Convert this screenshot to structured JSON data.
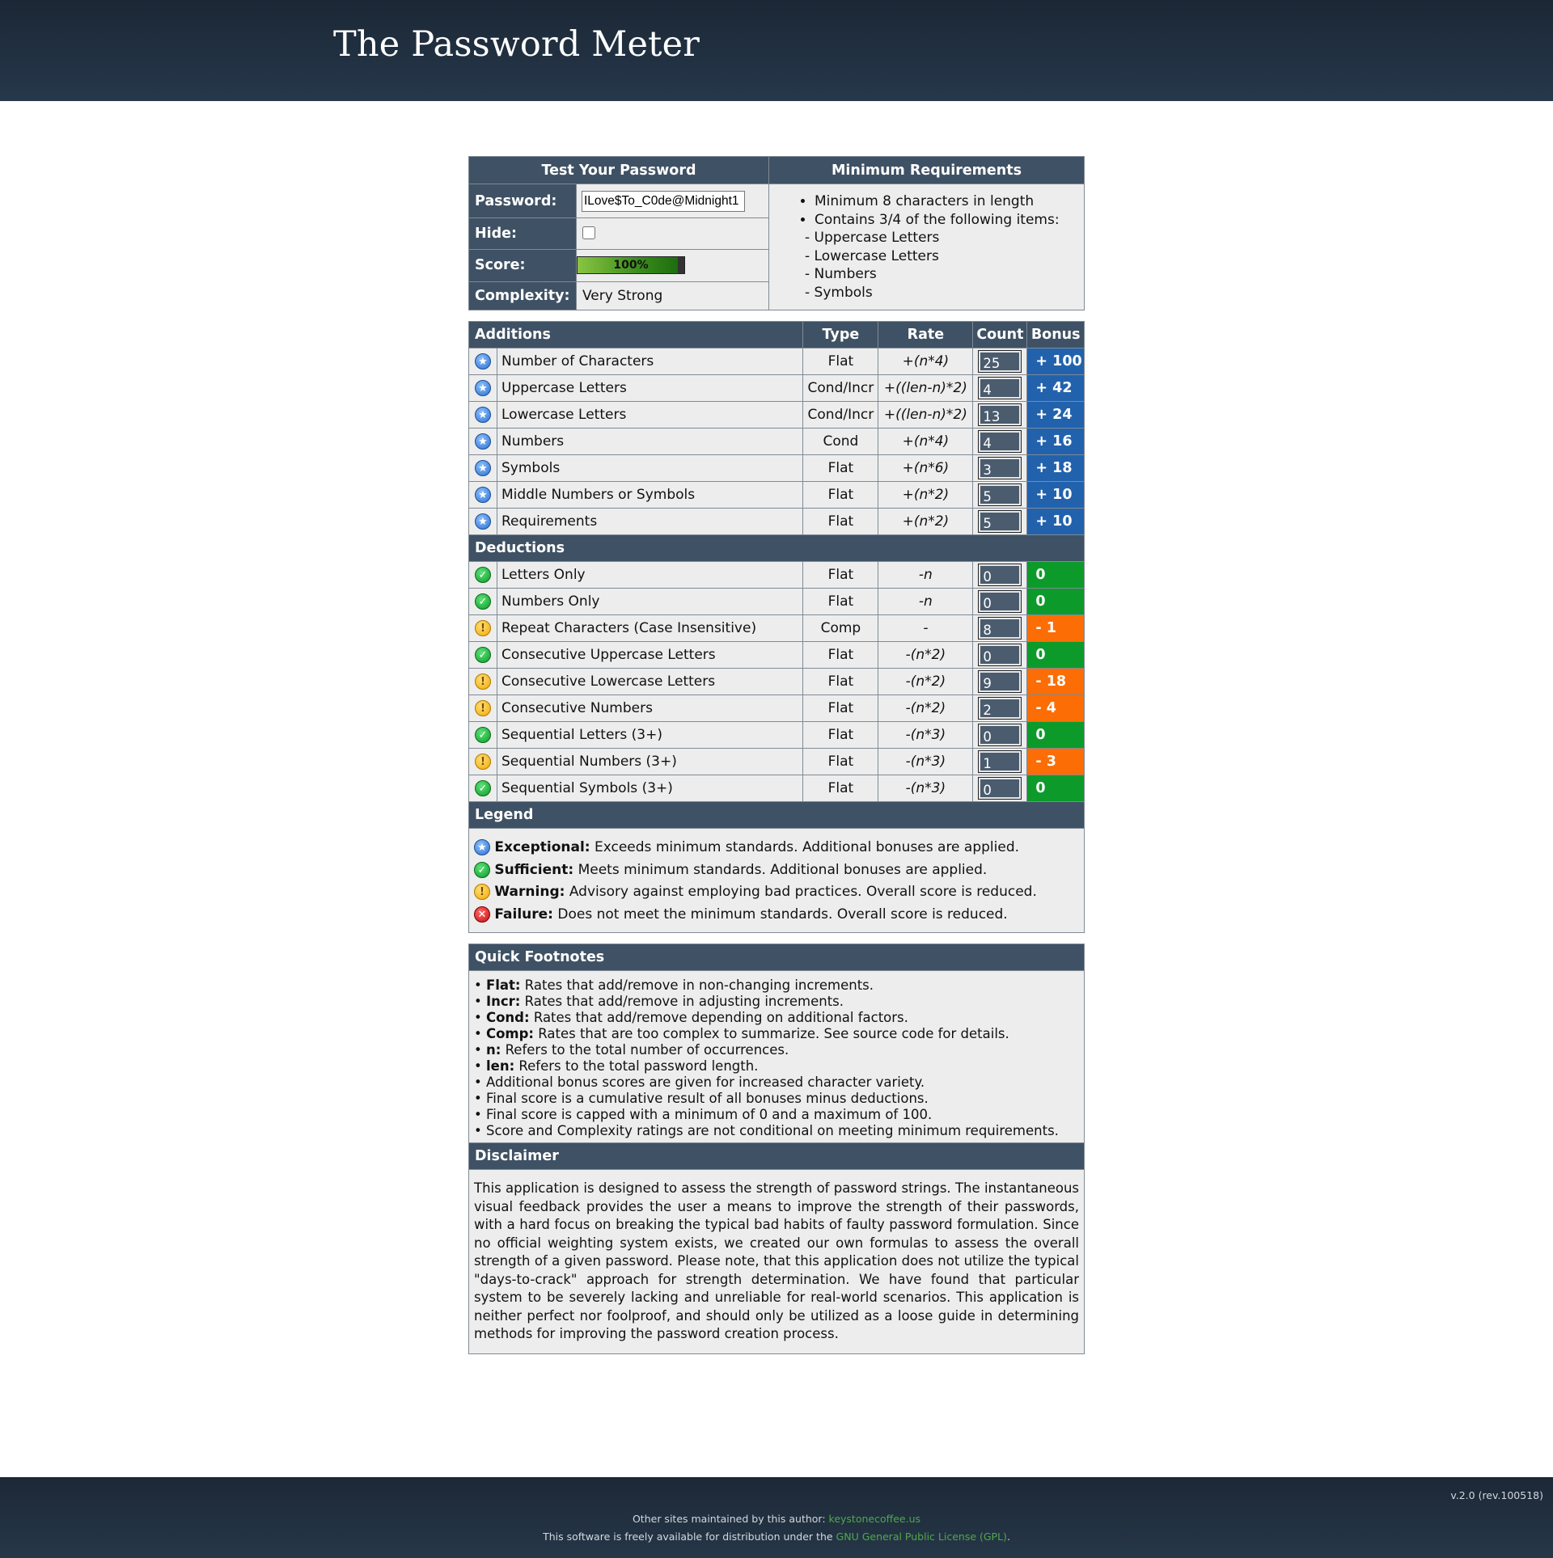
{
  "header": {
    "title": "The Password Meter"
  },
  "test": {
    "heading": "Test Your Password",
    "password_label": "Password:",
    "password_value": "ILove$To_C0de@Midnight1",
    "hide_label": "Hide:",
    "score_label": "Score:",
    "score_text": "100%",
    "score_fraction": 1.0,
    "complexity_label": "Complexity:",
    "complexity_value": "Very Strong"
  },
  "requirements": {
    "heading": "Minimum Requirements",
    "items": [
      "Minimum 8 characters in length",
      "Contains 3/4 of the following items:"
    ],
    "subitems": [
      "- Uppercase Letters",
      "- Lowercase Letters",
      "- Numbers",
      "- Symbols"
    ]
  },
  "additions": {
    "heading": "Additions",
    "col_type": "Type",
    "col_rate": "Rate",
    "col_count": "Count",
    "col_bonus": "Bonus",
    "rows": [
      {
        "name": "Number of Characters",
        "type": "Flat",
        "rate": "+(n*4)",
        "count": "25",
        "bonus": "+ 100",
        "status": "exceptional"
      },
      {
        "name": "Uppercase Letters",
        "type": "Cond/Incr",
        "rate": "+((len-n)*2)",
        "count": "4",
        "bonus": "+ 42",
        "status": "exceptional"
      },
      {
        "name": "Lowercase Letters",
        "type": "Cond/Incr",
        "rate": "+((len-n)*2)",
        "count": "13",
        "bonus": "+ 24",
        "status": "exceptional"
      },
      {
        "name": "Numbers",
        "type": "Cond",
        "rate": "+(n*4)",
        "count": "4",
        "bonus": "+ 16",
        "status": "exceptional"
      },
      {
        "name": "Symbols",
        "type": "Flat",
        "rate": "+(n*6)",
        "count": "3",
        "bonus": "+ 18",
        "status": "exceptional"
      },
      {
        "name": "Middle Numbers or Symbols",
        "type": "Flat",
        "rate": "+(n*2)",
        "count": "5",
        "bonus": "+ 10",
        "status": "exceptional"
      },
      {
        "name": "Requirements",
        "type": "Flat",
        "rate": "+(n*2)",
        "count": "5",
        "bonus": "+ 10",
        "status": "exceptional"
      }
    ]
  },
  "deductions": {
    "heading": "Deductions",
    "rows": [
      {
        "name": "Letters Only",
        "type": "Flat",
        "rate": "-n",
        "count": "0",
        "bonus": "0",
        "status": "sufficient"
      },
      {
        "name": "Numbers Only",
        "type": "Flat",
        "rate": "-n",
        "count": "0",
        "bonus": "0",
        "status": "sufficient"
      },
      {
        "name": "Repeat Characters (Case Insensitive)",
        "type": "Comp",
        "rate": "-",
        "count": "8",
        "bonus": "- 1",
        "status": "warning"
      },
      {
        "name": "Consecutive Uppercase Letters",
        "type": "Flat",
        "rate": "-(n*2)",
        "count": "0",
        "bonus": "0",
        "status": "sufficient"
      },
      {
        "name": "Consecutive Lowercase Letters",
        "type": "Flat",
        "rate": "-(n*2)",
        "count": "9",
        "bonus": "- 18",
        "status": "warning"
      },
      {
        "name": "Consecutive Numbers",
        "type": "Flat",
        "rate": "-(n*2)",
        "count": "2",
        "bonus": "- 4",
        "status": "warning"
      },
      {
        "name": "Sequential Letters (3+)",
        "type": "Flat",
        "rate": "-(n*3)",
        "count": "0",
        "bonus": "0",
        "status": "sufficient"
      },
      {
        "name": "Sequential Numbers (3+)",
        "type": "Flat",
        "rate": "-(n*3)",
        "count": "1",
        "bonus": "- 3",
        "status": "warning"
      },
      {
        "name": "Sequential Symbols (3+)",
        "type": "Flat",
        "rate": "-(n*3)",
        "count": "0",
        "bonus": "0",
        "status": "sufficient"
      }
    ]
  },
  "legend": {
    "heading": "Legend",
    "items": [
      {
        "term": "Exceptional:",
        "text": " Exceeds minimum standards. Additional bonuses are applied.",
        "icon": "exceptional-icon"
      },
      {
        "term": "Sufficient:",
        "text": " Meets minimum standards. Additional bonuses are applied.",
        "icon": "sufficient-icon"
      },
      {
        "term": "Warning:",
        "text": " Advisory against employing bad practices. Overall score is reduced.",
        "icon": "warning-icon"
      },
      {
        "term": "Failure:",
        "text": " Does not meet the minimum standards. Overall score is reduced.",
        "icon": "failure-icon"
      }
    ]
  },
  "footnotes": {
    "heading": "Quick Footnotes",
    "items": [
      {
        "term": "Flat:",
        "text": " Rates that add/remove in non-changing increments."
      },
      {
        "term": "Incr:",
        "text": " Rates that add/remove in adjusting increments."
      },
      {
        "term": "Cond:",
        "text": " Rates that add/remove depending on additional factors."
      },
      {
        "term": "Comp:",
        "text": " Rates that are too complex to summarize. See source code for details."
      },
      {
        "term": "n:",
        "text": " Refers to the total number of occurrences."
      },
      {
        "term": "len:",
        "text": " Refers to the total password length."
      },
      {
        "term": "",
        "text": "Additional bonus scores are given for increased character variety."
      },
      {
        "term": "",
        "text": "Final score is a cumulative result of all bonuses minus deductions."
      },
      {
        "term": "",
        "text": "Final score is capped with a minimum of 0 and a maximum of 100."
      },
      {
        "term": "",
        "text": "Score and Complexity ratings are not conditional on meeting minimum requirements."
      }
    ]
  },
  "disclaimer": {
    "heading": "Disclaimer",
    "text": "This application is designed to assess the strength of password strings. The instantaneous visual feedback provides the user a means to improve the strength of their passwords, with a hard focus on breaking the typical bad habits of faulty password formulation. Since no official weighting system exists, we created our own formulas to assess the overall strength of a given password. Please note, that this application does not utilize the typical \"days-to-crack\" approach for strength determination. We have found that particular system to be severely lacking and unreliable for real-world scenarios. This application is neither perfect nor foolproof, and should only be utilized as a loose guide in determining methods for improving the password creation process."
  },
  "footer": {
    "version": "v.2.0 (rev.100518)",
    "line1_prefix": "Other sites maintained by this author: ",
    "line1_link": "keystonecoffee.us",
    "line2_prefix": "This software is freely available for distribution under the ",
    "line2_link": "GNU General Public License (GPL)",
    "line2_suffix": "."
  },
  "colors": {
    "header_bg": "#1b2735",
    "section_bg": "#3f5164",
    "bonus_blue": "#2262ad",
    "bonus_green": "#0c9b2a",
    "bonus_orange": "#fc6d05"
  }
}
